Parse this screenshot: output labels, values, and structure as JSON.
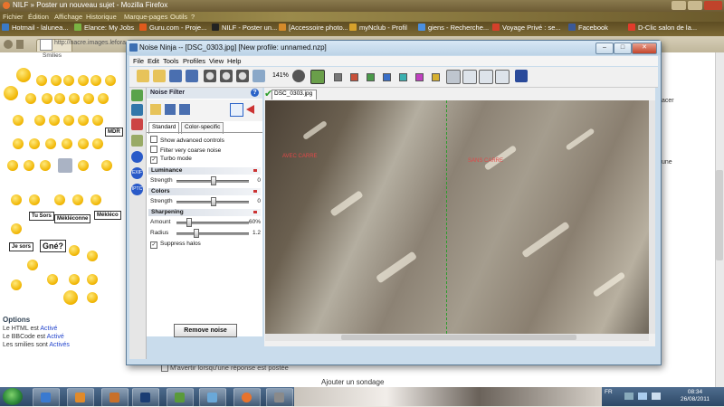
{
  "firefox": {
    "title": "NILF » Poster un nouveau sujet - Mozilla Firefox",
    "menu": [
      "Fichier",
      "Édition",
      "Affichage",
      "Historique",
      "Marque-pages",
      "Outils",
      "?"
    ],
    "bookmarks": [
      "Hotmail - lalunea...",
      "Elance: My Jobs",
      "Guru.com - Proje...",
      "NILF - Poster un...",
      "[Accessoire photo...",
      "myNclub - Profil",
      "giens - Recherche...",
      "Voyage Privé : se...",
      "Facebook",
      "D-Clic salon de la..."
    ],
    "tabs": [
      "",
      "NILF - Poster un..."
    ],
    "url": "http://nacre.images.lefora..."
  },
  "forum": {
    "smilies_header": "Smilies",
    "signs": [
      "MDR",
      "Tu Sors",
      "Mékléconne",
      "Mékléco",
      "Je sors",
      "Gné?"
    ],
    "options_title": "Options",
    "options_lines": [
      {
        "text": "Le HTML est ",
        "link": "Activé"
      },
      {
        "text": "Le BBCode est ",
        "link": "Activé"
      },
      {
        "text": "Les smilies sont ",
        "link": "Activés"
      }
    ],
    "notify_label": "M'avertir lorsqu'une réponse est postée",
    "add_poll": "Ajouter un sondage",
    "right_text_1": "acer",
    "right_text_2": "une"
  },
  "noise_ninja": {
    "title": "Noise Ninja -- [DSC_0303.jpg] [New profile: unnamed.nzp]",
    "window_buttons": {
      "minimize": "–",
      "maximize": "□",
      "close": "✕"
    },
    "menu": [
      "File",
      "Edit",
      "Tools",
      "Profiles",
      "View",
      "Help"
    ],
    "zoom": "141%",
    "filter_title": "Noise Filter",
    "help": "?",
    "tabs": [
      "Standard",
      "Color-specific"
    ],
    "checkboxes": [
      {
        "label": "Show advanced controls",
        "checked": false
      },
      {
        "label": "Filter very coarse noise",
        "checked": false
      },
      {
        "label": "Turbo mode",
        "checked": true
      }
    ],
    "luminance": {
      "title": "Luminance",
      "strength_label": "Strength",
      "strength_value": "0"
    },
    "colors": {
      "title": "Colors",
      "strength_label": "Strength",
      "strength_value": "0"
    },
    "sharpening": {
      "title": "Sharpening",
      "amount_label": "Amount",
      "amount_value": "60%",
      "radius_label": "Radius",
      "radius_value": "1.2"
    },
    "suppress_halos": {
      "label": "Suppress halos",
      "checked": true
    },
    "remove_noise": "Remove noise",
    "left_tools": [
      "EXIF",
      "IPTC"
    ],
    "image_tab": "DSC_0303.jpg",
    "checkmark": "✔",
    "left_label": "AVEC CARRE",
    "right_label": "SANS CARRE",
    "slider_levels": {
      "luminance": 0.5,
      "colors": 0.5,
      "amount": 0.15,
      "radius": 0.25
    }
  },
  "taskbar": {
    "language": "FR",
    "time": "08:34",
    "date": "26/08/2011"
  }
}
